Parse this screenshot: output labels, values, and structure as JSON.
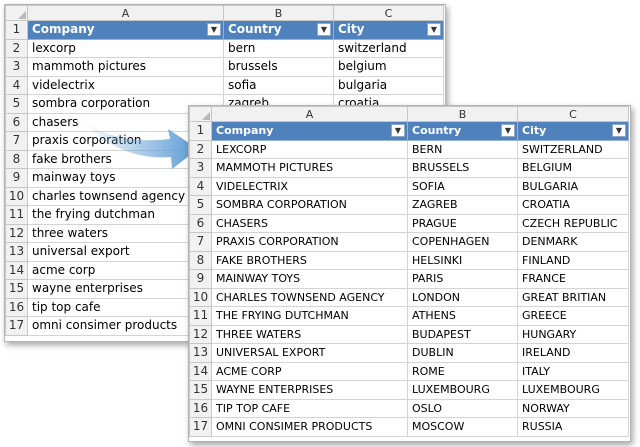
{
  "columns": [
    "A",
    "B",
    "C"
  ],
  "headers": [
    "Company",
    "Country",
    "City"
  ],
  "dropdown_icon": "▼",
  "before_rows": [
    [
      "lexcorp",
      "bern",
      "switzerland"
    ],
    [
      "mammoth pictures",
      "brussels",
      "belgium"
    ],
    [
      "videlectrix",
      "sofia",
      "bulgaria"
    ],
    [
      "sombra corporation",
      "zagreb",
      "croatia"
    ],
    [
      "chasers",
      "",
      ""
    ],
    [
      "praxis corporation",
      "",
      ""
    ],
    [
      "fake brothers",
      "",
      ""
    ],
    [
      "mainway toys",
      "",
      ""
    ],
    [
      "charles townsend agency",
      "",
      ""
    ],
    [
      "the frying dutchman",
      "",
      ""
    ],
    [
      "three waters",
      "",
      ""
    ],
    [
      "universal export",
      "",
      ""
    ],
    [
      "acme corp",
      "",
      ""
    ],
    [
      "wayne enterprises",
      "",
      ""
    ],
    [
      "tip top cafe",
      "",
      ""
    ],
    [
      "omni consimer products",
      "",
      ""
    ]
  ],
  "after_rows": [
    [
      "LEXCORP",
      "BERN",
      "SWITZERLAND"
    ],
    [
      "MAMMOTH PICTURES",
      "BRUSSELS",
      "BELGIUM"
    ],
    [
      "VIDELECTRIX",
      "SOFIA",
      "BULGARIA"
    ],
    [
      "SOMBRA CORPORATION",
      "ZAGREB",
      "CROATIA"
    ],
    [
      "CHASERS",
      "PRAGUE",
      "CZECH REPUBLIC"
    ],
    [
      "PRAXIS CORPORATION",
      "COPENHAGEN",
      "DENMARK"
    ],
    [
      "FAKE BROTHERS",
      "HELSINKI",
      "FINLAND"
    ],
    [
      "MAINWAY TOYS",
      "PARIS",
      "FRANCE"
    ],
    [
      "CHARLES TOWNSEND AGENCY",
      "LONDON",
      "GREAT BRITIAN"
    ],
    [
      "THE FRYING DUTCHMAN",
      "ATHENS",
      "GREECE"
    ],
    [
      "THREE WATERS",
      "BUDAPEST",
      "HUNGARY"
    ],
    [
      "UNIVERSAL EXPORT",
      "DUBLIN",
      "IRELAND"
    ],
    [
      "ACME CORP",
      "ROME",
      "ITALY"
    ],
    [
      "WAYNE ENTERPRISES",
      "LUXEMBOURG",
      "LUXEMBOURG"
    ],
    [
      "TIP TOP CAFE",
      "OSLO",
      "NORWAY"
    ],
    [
      "OMNI CONSIMER PRODUCTS",
      "MOSCOW",
      "RUSSIA"
    ]
  ],
  "colors": {
    "header_fill": "#4f81bd",
    "header_text": "#ffffff",
    "arrow": "#5b9bd5"
  }
}
